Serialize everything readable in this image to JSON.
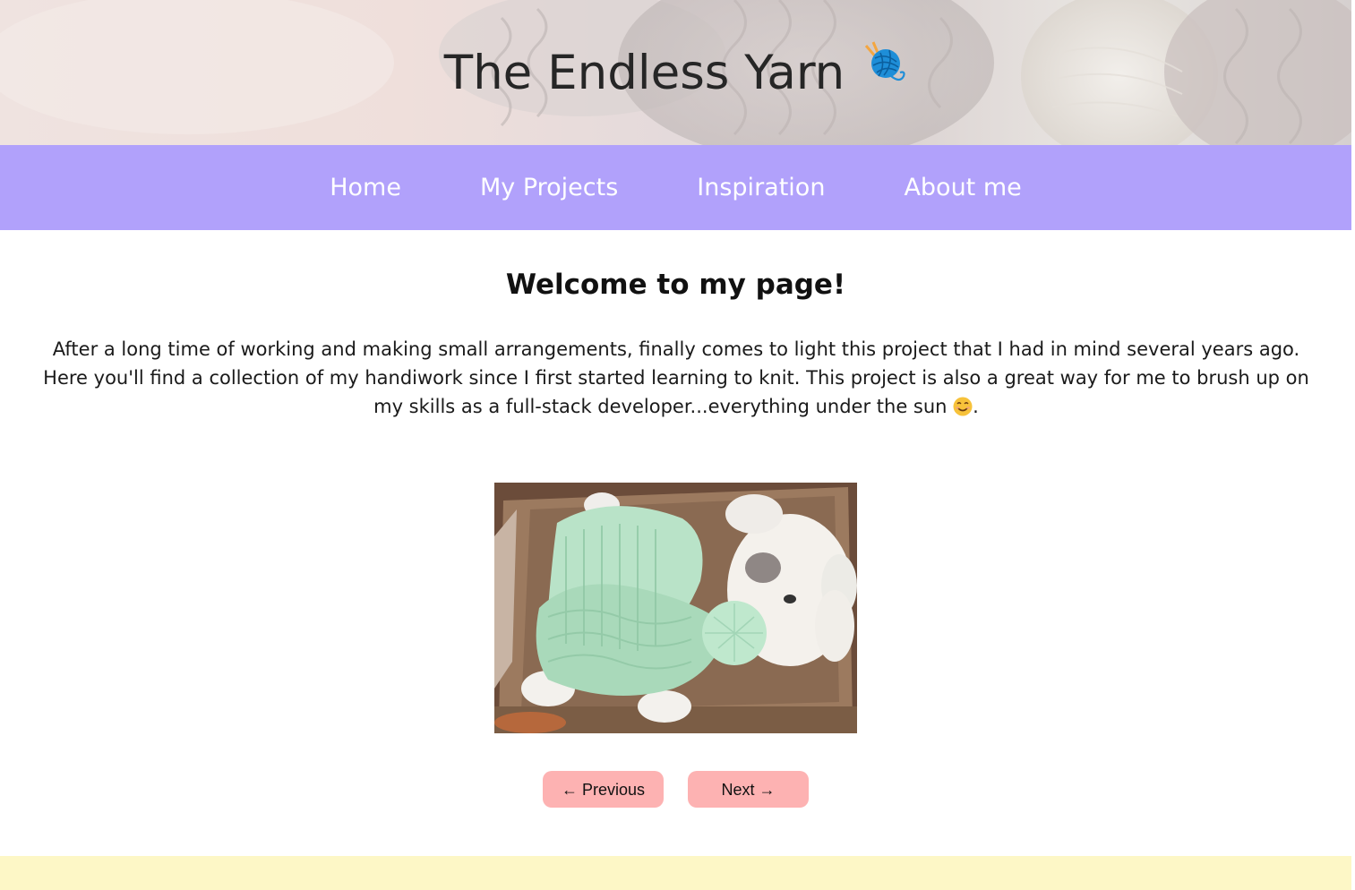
{
  "header": {
    "site_title": "The Endless Yarn",
    "title_icon": "yarn-ball-icon"
  },
  "nav": {
    "items": [
      {
        "label": "Home"
      },
      {
        "label": "My Projects"
      },
      {
        "label": "Inspiration"
      },
      {
        "label": "About me"
      }
    ]
  },
  "main": {
    "heading": "Welcome to my page!",
    "intro_text": "After a long time of working and making small arrangements, finally comes to light this project that I had in mind several years ago. Here you'll find a collection of my handiwork since I first started learning to knit. This project is also a great way for me to brush up on my skills as a full-stack developer...everything under the sun",
    "intro_end": ".",
    "intro_emoji": "smiling-face-icon"
  },
  "gallery": {
    "photo": "knitted-baby-outfit-photo",
    "prev_label": "← Previous",
    "next_label": "Next →"
  },
  "colors": {
    "nav_bg": "#b1a1fb",
    "button_bg": "#fdb2b2",
    "footer_bg": "#fdf7c6"
  }
}
